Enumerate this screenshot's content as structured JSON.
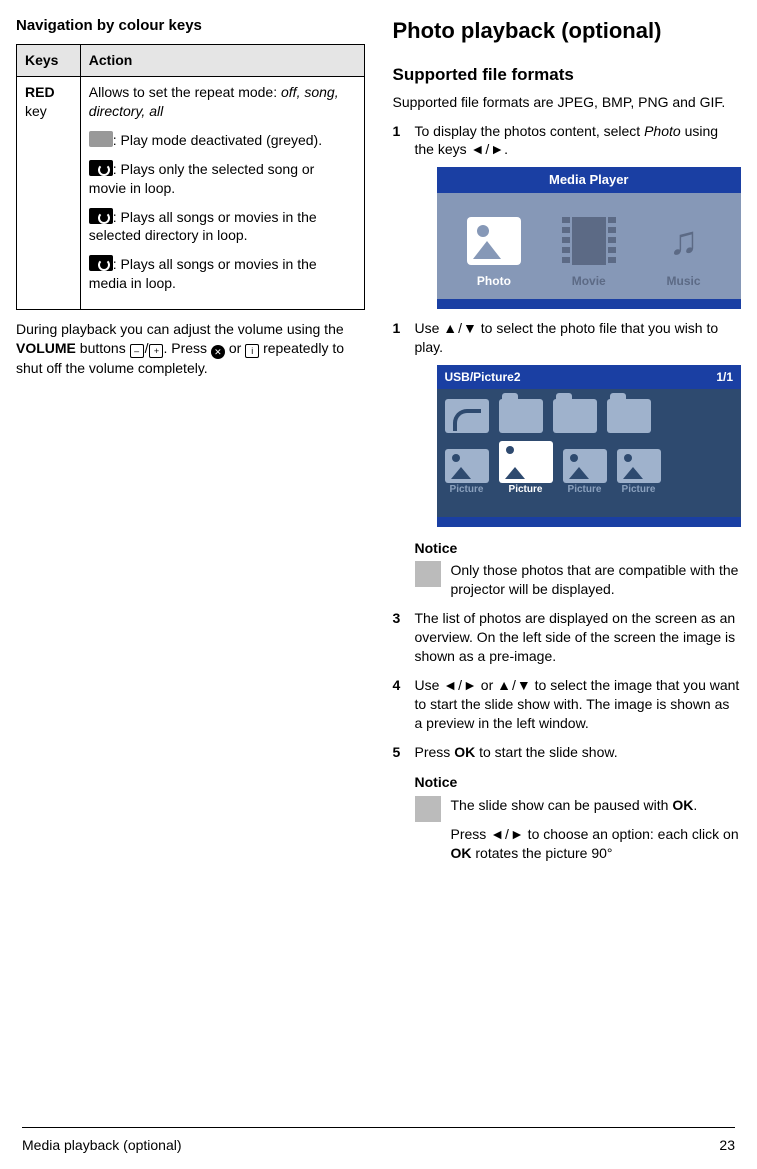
{
  "left": {
    "heading": "Navigation by colour keys",
    "th1": "Keys",
    "th2": "Action",
    "key_label_pre": "RED",
    "key_label_post": " key",
    "row_intro": "Allows to set the repeat mode: ",
    "row_modes": "off, song, directory, all",
    "mode_a": ": Play mode deactivated (greyed).",
    "mode_b": ": Plays only the selected song or movie in loop.",
    "mode_c": ": Plays all songs or movies in the selected directory in loop.",
    "mode_d": ": Plays all songs or movies in the media in loop.",
    "para_a": "During playback you can adjust the volume using the ",
    "para_vol": "VOLUME",
    "para_b": " buttons ",
    "para_c": ". Press ",
    "para_d": " or ",
    "para_e": " repeatedly to shut off the volume completely."
  },
  "right": {
    "h1": "Photo playback (optional)",
    "h2": "Supported file formats",
    "formats": "Supported file formats are JPEG, BMP, PNG and GIF.",
    "s1a": "To display the photos content, select ",
    "s1b": "Photo",
    "s1c": " using the keys ",
    "mp_title": "Media Player",
    "mp_photo": "Photo",
    "mp_movie": "Movie",
    "mp_music": "Music",
    "s1_post_a": "Use ",
    "s1_post_b": " to select the photo file that you wish to play.",
    "usb_path": "USB/Picture2",
    "usb_count": "1/1",
    "pic": "Picture",
    "notice": "Notice",
    "notice1": "Only those photos that are compatible with the projector will be displayed.",
    "s2": "The list of photos are displayed on the screen as an overview. On the left side of the screen the image is shown as a pre-image.",
    "s3a": "Use ",
    "s3b": " or ",
    "s3c": " to select the image that you want to start the slide show with. The image is shown as a preview in the left window.",
    "s4a": "Press ",
    "s4b": "OK",
    "s4c": " to start the slide show.",
    "notice2a": "The slide show can be paused with ",
    "notice2b": "OK",
    "notice2c": ".",
    "notice3a": "Press ",
    "notice3b": " to choose an option: each click on ",
    "notice3c": "OK",
    "notice3d": " rotates the picture 90°"
  },
  "footer": {
    "section": "Media playback (optional)",
    "page": "23"
  }
}
